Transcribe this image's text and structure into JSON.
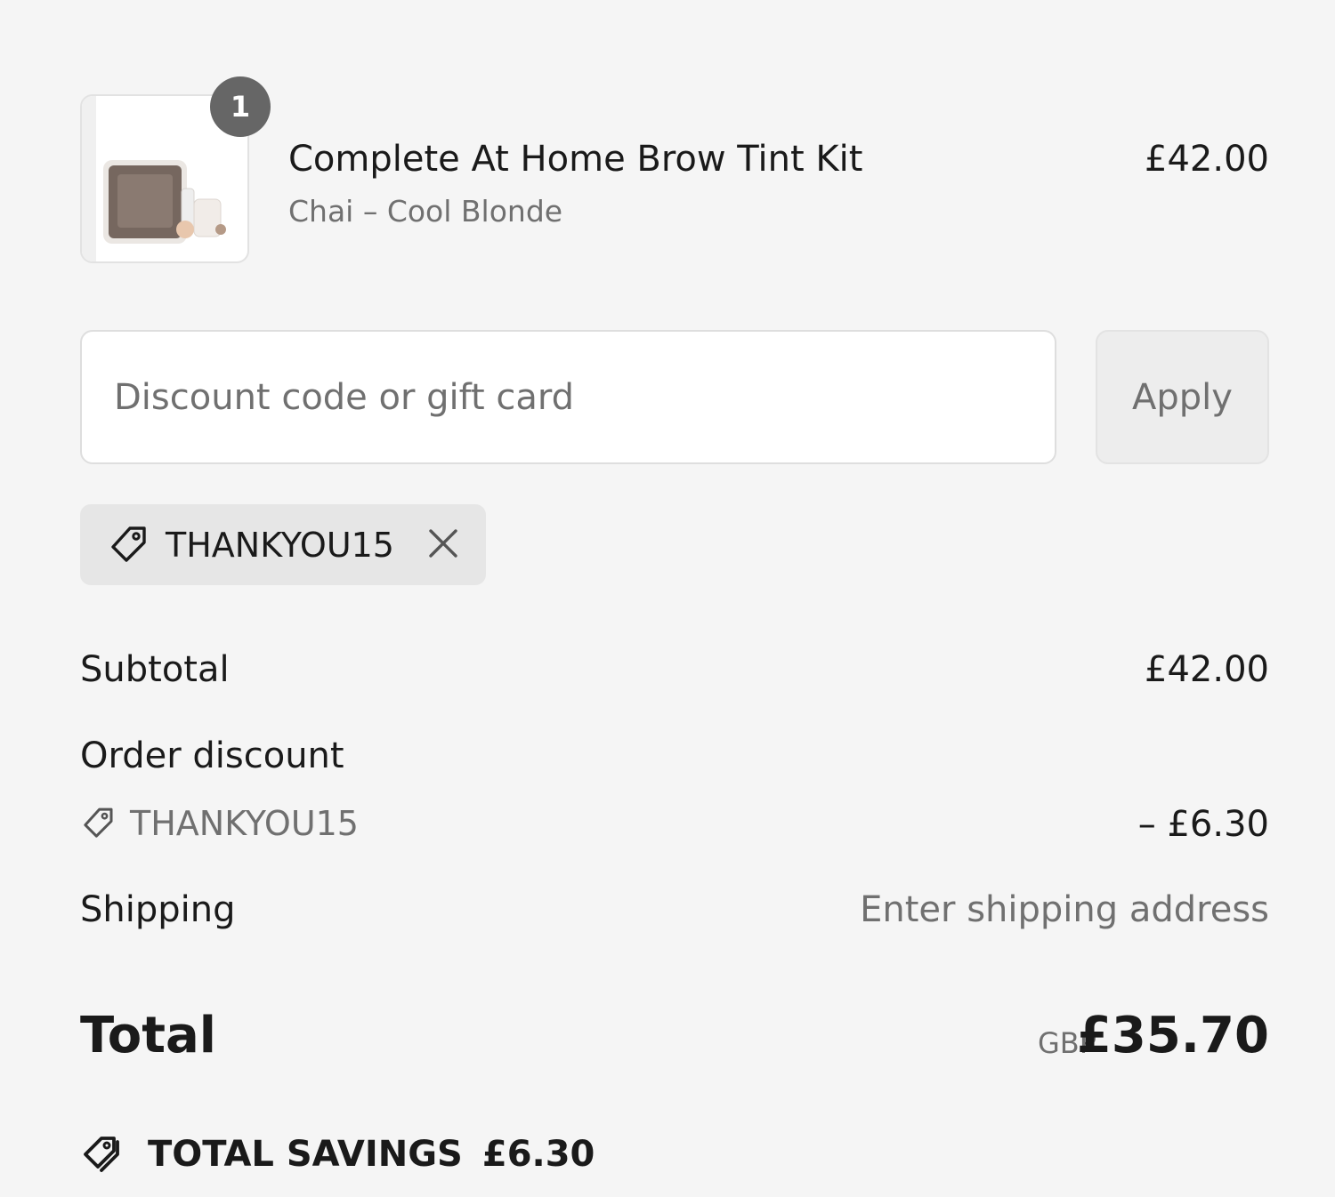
{
  "line_item": {
    "quantity": "1",
    "title": "Complete At Home Brow Tint Kit",
    "variant": "Chai – Cool Blonde",
    "price": "£42.00",
    "image_icon": "product-image"
  },
  "discount_form": {
    "placeholder": "Discount code or gift card",
    "value": "",
    "apply_label": "Apply"
  },
  "applied_code": {
    "code": "THANKYOU15",
    "tag_icon": "tag-icon",
    "remove_icon": "close-icon"
  },
  "summary": {
    "subtotal_label": "Subtotal",
    "subtotal_value": "£42.00",
    "order_discount_label": "Order discount",
    "order_discount_code": "THANKYOU15",
    "order_discount_value": "– £6.30",
    "shipping_label": "Shipping",
    "shipping_value": "Enter shipping address"
  },
  "total": {
    "label": "Total",
    "currency": "GBP",
    "value": "£35.70"
  },
  "savings": {
    "label": "TOTAL SAVINGS",
    "amount": "£6.30",
    "icon": "savings-tag-icon"
  },
  "colors": {
    "background": "#f5f5f5",
    "text": "#1a1a1a",
    "muted_text": "#707070",
    "badge": "#666666",
    "chip_background": "#e6e6e6"
  }
}
